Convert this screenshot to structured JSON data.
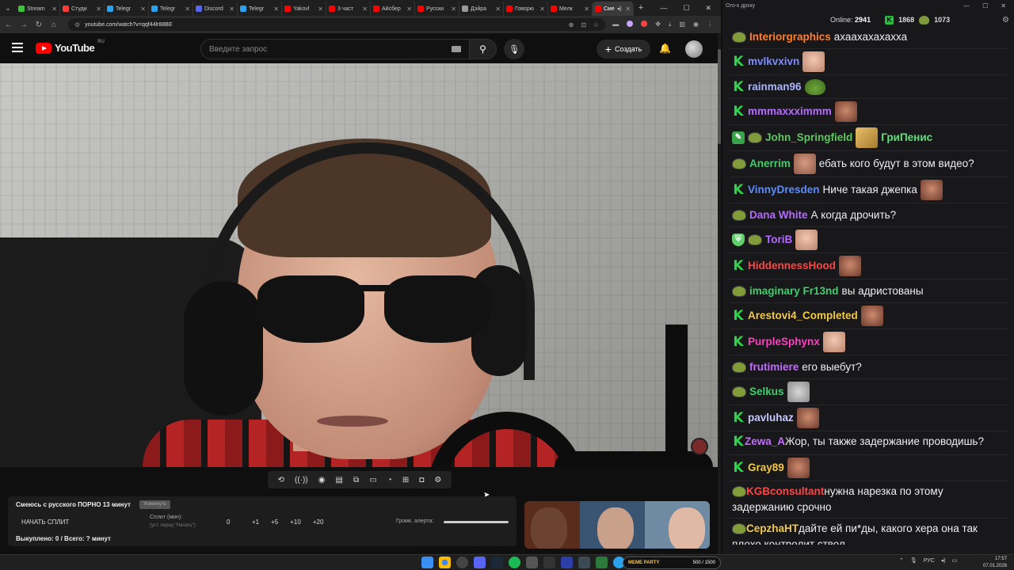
{
  "browser": {
    "tabs": [
      {
        "label": "Stream",
        "color": "#3ac43a"
      },
      {
        "label": "Студи",
        "color": "#ff3b3b"
      },
      {
        "label": "Telegr",
        "color": "#2aa3ef"
      },
      {
        "label": "Telegr",
        "color": "#2aa3ef"
      },
      {
        "label": "Discord",
        "color": "#5865f2"
      },
      {
        "label": "Telegr",
        "color": "#2aa3ef"
      },
      {
        "label": "Yakovl",
        "color": "#ff0000"
      },
      {
        "label": "3 част",
        "color": "#ff0000"
      },
      {
        "label": "Айсбер",
        "color": "#ff0000"
      },
      {
        "label": "Русски",
        "color": "#ff0000"
      },
      {
        "label": "Дэйра",
        "color": "#9a9a9a"
      },
      {
        "label": "Говорю",
        "color": "#ff0000"
      },
      {
        "label": "Мелк",
        "color": "#ff0000"
      }
    ],
    "active_tab_label": "Сме",
    "url": "youtube.com/watch?v=qqf44lr88BE"
  },
  "youtube": {
    "logo": "YouTube",
    "region": "RU",
    "search_placeholder": "Введите запрос",
    "create_label": "Создать"
  },
  "below_video": {
    "panel_title": "Смеюсь с русского ПОРНО 13 минут",
    "panel_tag": "Усмехнуть",
    "start_split": "НАЧАТЬ СПЛИТ",
    "split_label": "Сплит (мин):",
    "split_hint": "(уст. перед \"Начать\")",
    "split_value": "0",
    "increments": [
      "+1",
      "+5",
      "+10",
      "+20"
    ],
    "volume_label": "Громк. алерта:",
    "bought": "Выкуплено: 0 / Всего: ? минут"
  },
  "chat": {
    "window_title": "Ого-к дрхку",
    "online_label": "Online:",
    "online_count": "2941",
    "k_count": "1868",
    "pepe_count": "1073",
    "messages": [
      {
        "badge": "pepe",
        "user": "Interiorgraphics",
        "color": "#ff7f2a",
        "text": "ахаахахахахха",
        "emote": ""
      },
      {
        "badge": "k",
        "user": "mvlkvxivn",
        "color": "#7b8cff",
        "text": "",
        "emote": "face-c"
      },
      {
        "badge": "k",
        "user": "rainman96",
        "color": "#a8b4ff",
        "text": "",
        "emote": "frog"
      },
      {
        "badge": "k",
        "user": "mmmaxxximmm",
        "color": "#b56bff",
        "text": "",
        "emote": "face-b"
      },
      {
        "badge": "pencil",
        "badge2": "pepe",
        "user": "John_Springfield",
        "color": "#5cc95c",
        "text": "ГриПенис",
        "emote": "gold",
        "text_after_emote": true,
        "text_color": "#5ce07a"
      },
      {
        "badge": "pepe",
        "user": "Anerrim",
        "color": "#3fcf6b",
        "text": "ебать кого будут в этом видео?",
        "emote": "face-a",
        "emote_before_text": true
      },
      {
        "badge": "k",
        "user": "VinnyDresden",
        "color": "#5a8cff",
        "text": "Ниче такая джепка",
        "emote": "face-b"
      },
      {
        "badge": "pepe",
        "user": "Dana White",
        "color": "#b36bff",
        "text": "А когда дрочить?",
        "emote": ""
      },
      {
        "badge": "shield",
        "badge2": "pepe",
        "user": "ToriB",
        "color": "#b36bff",
        "text": "",
        "emote": "face-c"
      },
      {
        "badge": "k",
        "user": "HiddennessHood",
        "color": "#ff4444",
        "text": "",
        "emote": "face-b"
      },
      {
        "badge": "pepe",
        "user": "imaginary Fr13nd",
        "color": "#3fcf6b",
        "text": "вы адристованы",
        "emote": ""
      },
      {
        "badge": "k",
        "user": "Arestovi4_Completed",
        "color": "#f0c94a",
        "text": "",
        "emote": "face-b"
      },
      {
        "badge": "k",
        "user": "PurpleSphynx",
        "color": "#ff3fbf",
        "text": "",
        "emote": "face-c"
      },
      {
        "badge": "pepe",
        "user": "frutimiere",
        "color": "#c36bff",
        "text": "его выебут?",
        "emote": ""
      },
      {
        "badge": "pepe",
        "user": "Selkus",
        "color": "#3fcf6b",
        "text": "",
        "emote": "cat"
      },
      {
        "badge": "k",
        "user": "pavluhaz",
        "color": "#c8c8ff",
        "text": "",
        "emote": "face-b"
      },
      {
        "badge": "k",
        "user": "Zewa_A",
        "color": "#c36bff",
        "text": "Жор, ты также задержание проводишь?",
        "emote": "",
        "wrap": true
      },
      {
        "badge": "k",
        "user": "Gray89",
        "color": "#f0c94a",
        "text": "",
        "emote": "face-b"
      },
      {
        "badge": "pepe",
        "user": "KGBconsultant",
        "color": "#ff4444",
        "text": "нужна нарезка по этому задержанию срочно",
        "emote": "",
        "wrap": true
      },
      {
        "badge": "pepe",
        "user": "CepzhaHT",
        "color": "#f0c94a",
        "text": "дайте ей пи*ды, какого хера она так плохо контролит ствол",
        "emote": "",
        "wrap": true
      }
    ]
  },
  "taskbar": {
    "widget_brand": "MEME PARTY",
    "widget_value": "500 / 1500",
    "lang": "РУС",
    "time": "17:57",
    "date": "07.01.2026"
  }
}
